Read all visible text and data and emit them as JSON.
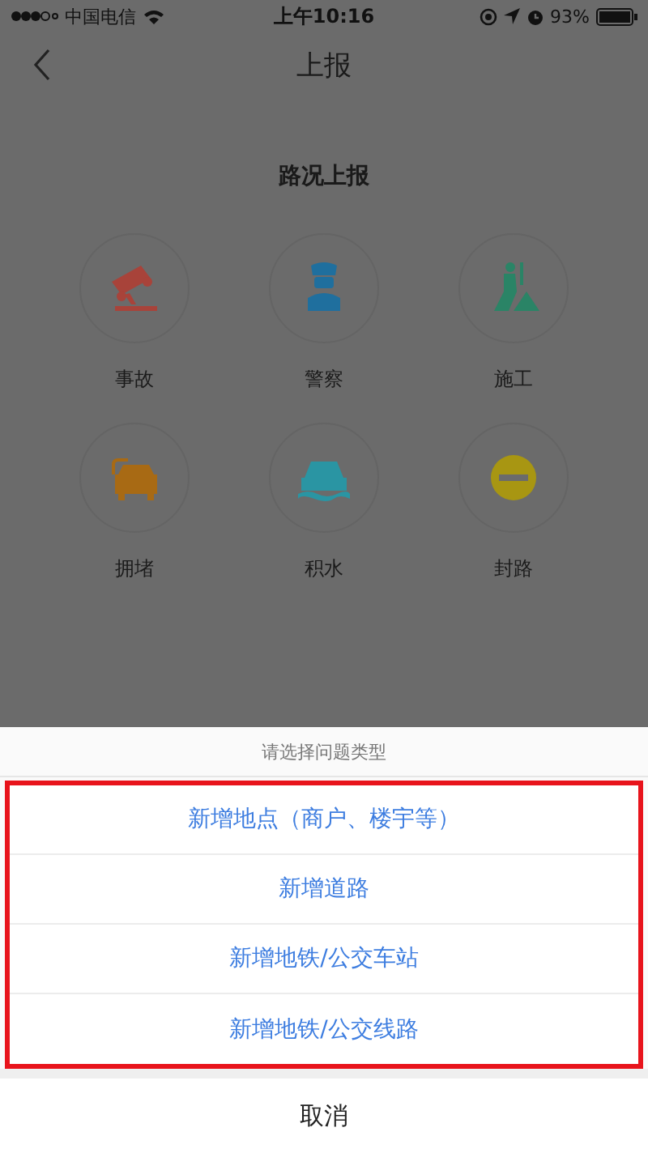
{
  "status_bar": {
    "carrier": "中国电信",
    "time": "上午10:16",
    "battery": "93%"
  },
  "nav": {
    "title": "上报"
  },
  "section": {
    "title": "路况上报",
    "items": [
      {
        "label": "事故",
        "kind": "accident",
        "color": "#a8433a"
      },
      {
        "label": "警察",
        "kind": "police",
        "color": "#1f6f9e"
      },
      {
        "label": "施工",
        "kind": "construction",
        "color": "#2a8466"
      },
      {
        "label": "拥堵",
        "kind": "jam",
        "color": "#a86a14"
      },
      {
        "label": "积水",
        "kind": "water",
        "color": "#2a95a3"
      },
      {
        "label": "封路",
        "kind": "closure",
        "color": "#a89612"
      }
    ]
  },
  "sheet": {
    "title": "请选择问题类型",
    "options": [
      "新增地点（商户、楼宇等）",
      "新增道路",
      "新增地铁/公交车站",
      "新增地铁/公交线路"
    ],
    "cancel": "取消"
  }
}
